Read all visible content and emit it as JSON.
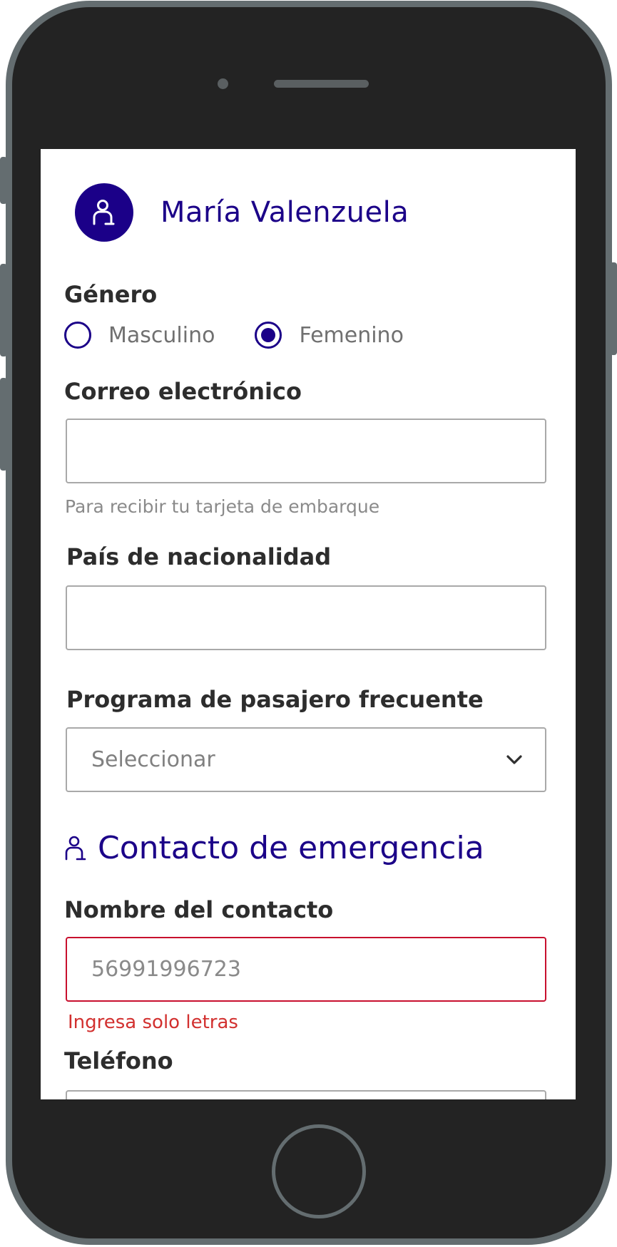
{
  "passenger": {
    "name": "María Valenzuela"
  },
  "gender": {
    "label": "Género",
    "options": [
      {
        "label": "Masculino",
        "selected": false
      },
      {
        "label": "Femenino",
        "selected": true
      }
    ]
  },
  "email": {
    "label": "Correo electrónico",
    "value": "",
    "hint": "Para recibir tu tarjeta de embarque"
  },
  "nationality": {
    "label": "País de nacionalidad",
    "value": ""
  },
  "frequent_flyer": {
    "label": "Programa de pasajero frecuente",
    "selected": "Seleccionar"
  },
  "emergency_contact": {
    "title": "Contacto de emergencia",
    "name_label": "Nombre del contacto",
    "name_value": "56991996723",
    "name_error": "Ingresa solo letras",
    "phone_label": "Teléfono"
  },
  "colors": {
    "brand": "#1b0088",
    "error": "#d2302f",
    "border": "#a9a9a9",
    "device_frame": "#646d70",
    "device_body": "#232323"
  },
  "icons": [
    "person-icon",
    "chevron-down-icon",
    "camera-icon",
    "speaker-icon",
    "home-button"
  ]
}
